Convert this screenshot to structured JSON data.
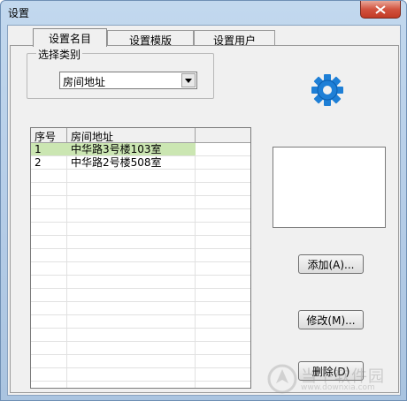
{
  "window": {
    "title": "设置"
  },
  "tabs": [
    {
      "label": "设置名目"
    },
    {
      "label": "设置模版"
    },
    {
      "label": "设置用户"
    }
  ],
  "category": {
    "group_label": "选择类别",
    "selected": "房间地址"
  },
  "table": {
    "columns": [
      "序号",
      "房间地址"
    ],
    "rows": [
      {
        "index": "1",
        "address": "中华路3号楼103室"
      },
      {
        "index": "2",
        "address": "中华路2号楼508室"
      }
    ]
  },
  "buttons": {
    "add": "添加(A)...",
    "edit": "修改(M)...",
    "delete": "删除(D)"
  },
  "watermark": {
    "text": "当下软件园",
    "url": "www.downxia.com"
  },
  "icons": {
    "gear": "gear-icon",
    "close": "close-icon"
  },
  "colors": {
    "accent": "#1e7fd6",
    "selected_row": "#cbe6b2",
    "close": "#c23a25"
  }
}
